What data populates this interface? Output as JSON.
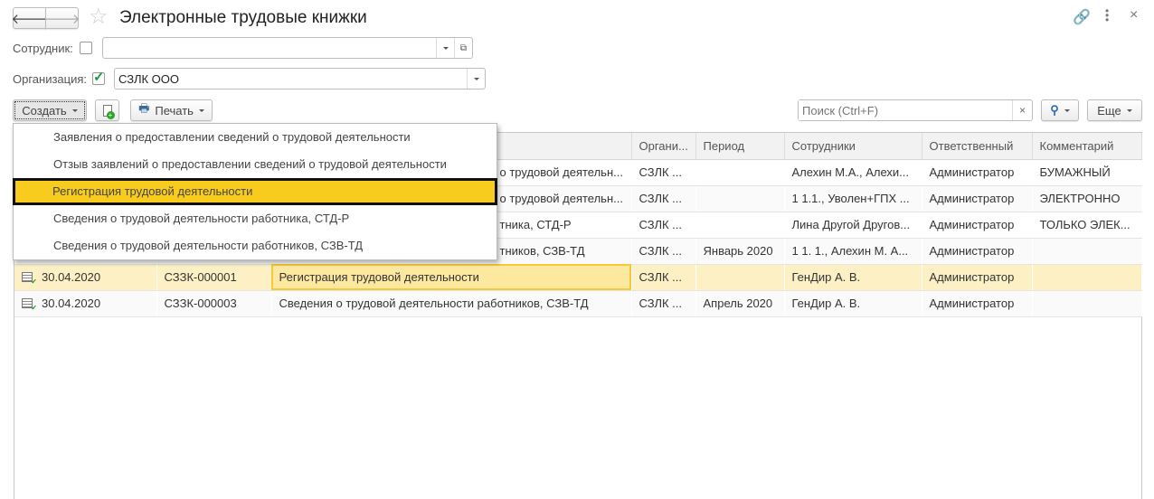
{
  "window": {
    "title": "Электронные трудовые книжки"
  },
  "filters": {
    "employee_label": "Сотрудник:",
    "employee_checked": false,
    "employee_value": "",
    "org_label": "Организация:",
    "org_checked": true,
    "org_value": "СЗЛК ООО"
  },
  "toolbar": {
    "create_label": "Создать",
    "print_label": "Печать",
    "search_placeholder": "Поиск (Ctrl+F)",
    "search_clear": "×",
    "more_label": "Еще"
  },
  "create_menu": {
    "items": [
      {
        "label": "Заявления о предоставлении сведений о трудовой деятельности"
      },
      {
        "label": "Отзыв заявлений о предоставлении сведений о трудовой деятельности"
      },
      {
        "label": "Регистрация трудовой деятельности"
      },
      {
        "label": "Сведения о трудовой деятельности работника, СТД-Р"
      },
      {
        "label": "Сведения о трудовой деятельности работников, СЗВ-ТД"
      }
    ],
    "active_index": 2
  },
  "table": {
    "columns": [
      "",
      "",
      "",
      "Органи...",
      "Период",
      "Сотрудники",
      "Ответственный",
      "Комментарий"
    ],
    "rows": [
      {
        "date": "",
        "number": "",
        "doc": "о трудовой деятельн...",
        "org": "СЗЛК ...",
        "period": "",
        "employees": "Алехин М.А., Алехи...",
        "responsible": "Администратор",
        "comment": "БУМАЖНЫЙ"
      },
      {
        "date": "",
        "number": "",
        "doc": "о трудовой деятельн...",
        "org": "СЗЛК ...",
        "period": "",
        "employees": "1 1.1., Уволен+ГПХ ...",
        "responsible": "Администратор",
        "comment": "ЭЛЕКТРОННО"
      },
      {
        "date": "",
        "number": "",
        "doc": "тника, СТД-Р",
        "org": "СЗЛК ...",
        "period": "",
        "employees": "Лина Другой Другов...",
        "responsible": "Администратор",
        "comment": "ТОЛЬКО ЭЛЕК..."
      },
      {
        "date": "",
        "number": "",
        "doc": "тников, СЗВ-ТД",
        "org": "СЗЛК ...",
        "period": "Январь 2020",
        "employees": "1 1. 1., Алехин М. А...",
        "responsible": "Администратор",
        "comment": ""
      },
      {
        "date": "30.04.2020",
        "number": "СЗЗК-000001",
        "doc": "Регистрация трудовой деятельности",
        "org": "СЗЛК ...",
        "period": "",
        "employees": "ГенДир А. В.",
        "responsible": "Администратор",
        "comment": ""
      },
      {
        "date": "30.04.2020",
        "number": "СЗЗК-000003",
        "doc": "Сведения о трудовой деятельности работников, СЗВ-ТД",
        "org": "СЗЛК ...",
        "period": "Апрель 2020",
        "employees": "ГенДир А. В.",
        "responsible": "Администратор",
        "comment": ""
      }
    ],
    "selected_row": 4
  }
}
